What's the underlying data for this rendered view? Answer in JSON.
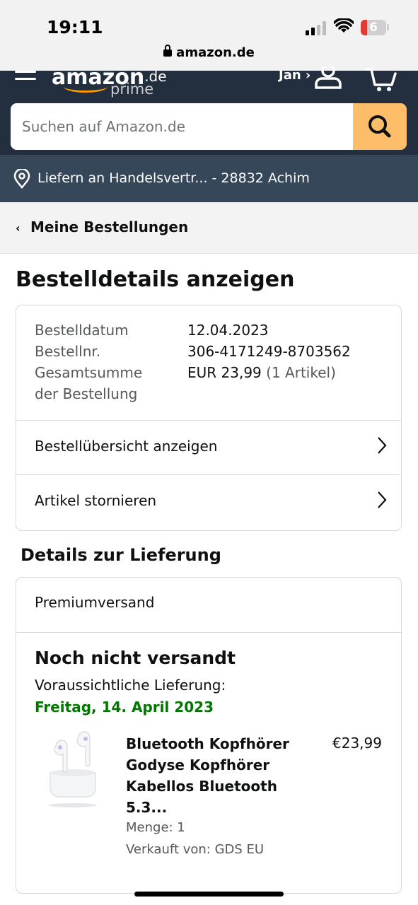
{
  "status_bar": {
    "time": "19:11",
    "battery": "6",
    "url": "amazon.de"
  },
  "header": {
    "logo_text": "amazon",
    "logo_suffix": ".de",
    "prime": "prime",
    "account": "Jan ›",
    "search_placeholder": "Suchen auf Amazon.de"
  },
  "deliver_bar": {
    "text": "Liefern an Handelsvertr... - 28832 Achim"
  },
  "breadcrumb": {
    "chevron": "‹",
    "label": "Meine Bestellungen"
  },
  "page_title": "Bestelldetails anzeigen",
  "order_summary": {
    "date_label": "Bestelldatum",
    "date_value": "12.04.2023",
    "number_label": "Bestellnr.",
    "number_value": "306-4171249-8703562",
    "total_label_1": "Gesamtsumme",
    "total_label_2": "der Bestellung",
    "total_value": "EUR 23,99",
    "total_items": "(1 Artikel)",
    "link_overview": "Bestellübersicht anzeigen",
    "link_cancel": "Artikel stornieren"
  },
  "delivery": {
    "section_title": "Details zur Lieferung",
    "shipping_method": "Premiumversand",
    "status": "Noch nicht versandt",
    "eta_label": "Voraussichtliche Lieferung:",
    "eta_date": "Freitag, 14. April 2023",
    "item": {
      "title": "Bluetooth Kopfhörer Godyse Kopfhörer Kabellos Bluetooth 5.3...",
      "price": "€23,99",
      "quantity": "Menge: 1",
      "seller": "Verkauft von: GDS EU"
    }
  },
  "colors": {
    "header": "#232f3e",
    "deliver_bar": "#37475a",
    "search_button": "#febd69",
    "eta_green": "#007600"
  }
}
